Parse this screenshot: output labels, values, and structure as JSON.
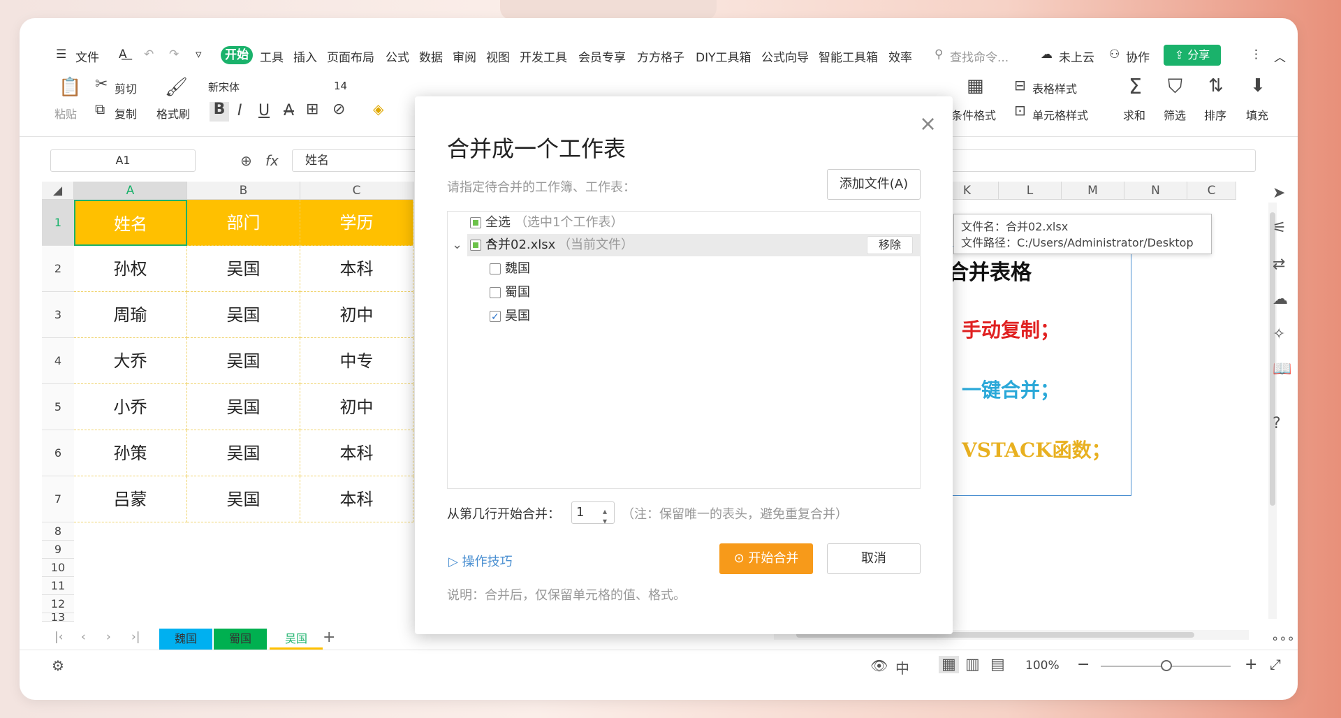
{
  "menu": {
    "file": "文件",
    "tabs": [
      "开始",
      "工具",
      "插入",
      "页面布局",
      "公式",
      "数据",
      "审阅",
      "视图",
      "开发工具",
      "会员专享",
      "方方格子",
      "DIY工具箱",
      "公式向导",
      "智能工具箱",
      "效率"
    ],
    "search_placeholder": "查找命令...",
    "cloud": "未上云",
    "collab": "协作",
    "share": "分享"
  },
  "ribbon": {
    "cut": "剪切",
    "paste": "粘贴",
    "copy": "复制",
    "format_painter": "格式刷",
    "font": "新宋体",
    "font_size": "14",
    "table_style": "表格样式",
    "cond_format": "条件格式",
    "cell_style": "单元格样式",
    "sum": "求和",
    "filter": "筛选",
    "sort": "排序",
    "fill": "填充"
  },
  "formula_bar": {
    "cell_ref": "A1",
    "fx": "fx",
    "content": "姓名"
  },
  "sheet": {
    "columns": [
      "A",
      "B",
      "C"
    ],
    "right_columns": [
      "K",
      "L",
      "M",
      "N",
      "C"
    ],
    "rows": [
      "1",
      "2",
      "3",
      "4",
      "5",
      "6",
      "7",
      "8",
      "9",
      "10",
      "11",
      "12",
      "13"
    ],
    "header": [
      "姓名",
      "部门",
      "学历"
    ],
    "data": [
      [
        "孙权",
        "吴国",
        "本科"
      ],
      [
        "周瑜",
        "吴国",
        "初中"
      ],
      [
        "大乔",
        "吴国",
        "中专"
      ],
      [
        "小乔",
        "吴国",
        "初中"
      ],
      [
        "孙策",
        "吴国",
        "本科"
      ],
      [
        "吕蒙",
        "吴国",
        "本科"
      ]
    ]
  },
  "textbox": {
    "title": "合并表格",
    "line1": "：手动复制；",
    "line2": "：一键合并；",
    "line3": "：VSTACK函数；"
  },
  "tooltip": {
    "name": "文件名：合并02.xlsx",
    "path": "文件路径：C:/Users/Administrator/Desktop"
  },
  "dialog": {
    "title": "合并成一个工作表",
    "subtitle": "请指定待合并的工作簿、工作表：",
    "add_file": "添加文件(A)",
    "select_all": "全选",
    "select_all_hint": "（选中1个工作表）",
    "file_name": "合并02.xlsx",
    "file_hint": "（当前文件）",
    "remove": "移除",
    "sheets": [
      {
        "name": "魏国",
        "checked": false
      },
      {
        "name": "蜀国",
        "checked": false
      },
      {
        "name": "吴国",
        "checked": true
      }
    ],
    "start_row_label": "从第几行开始合并：",
    "start_row_value": "1",
    "start_row_note": "（注：保留唯一的表头，避免重复合并）",
    "tips": "操作技巧",
    "start": "开始合并",
    "cancel": "取消",
    "note": "说明：合并后，仅保留单元格的值、格式。"
  },
  "sheet_tabs": [
    {
      "name": "魏国",
      "color": "#00b0f0"
    },
    {
      "name": "蜀国",
      "color": "#00b050"
    },
    {
      "name": "吴国",
      "color": "#ffffff"
    }
  ],
  "status": {
    "zoom": "100%"
  },
  "colors": {
    "accent": "#1ab26b",
    "header_fill": "#ffc000",
    "start_button": "#f79a1a"
  }
}
